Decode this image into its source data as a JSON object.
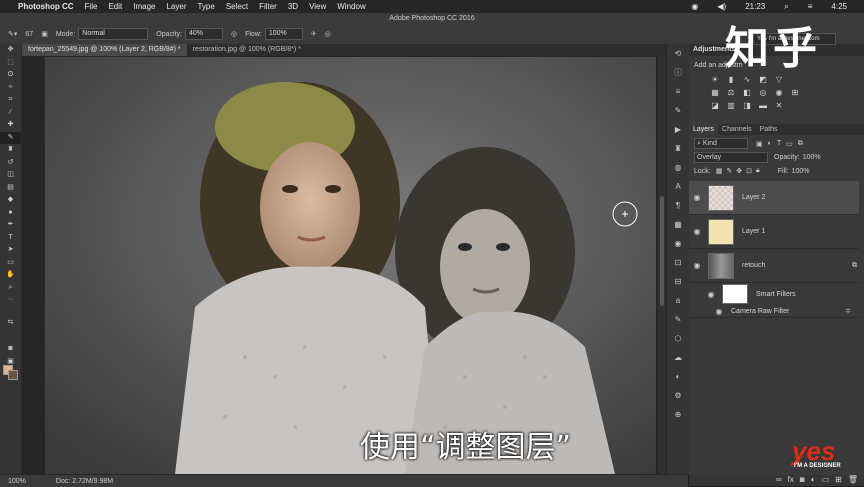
{
  "menubar": {
    "app_name": "Photoshop CC",
    "items": [
      "File",
      "Edit",
      "Image",
      "Layer",
      "Type",
      "Select",
      "Filter",
      "3D",
      "View",
      "Window"
    ],
    "clock": "21:23",
    "time": "4:25"
  },
  "window_title": "Adobe Photoshop CC 2016",
  "options_bar": {
    "brush_size": "67",
    "mode_label": "Mode:",
    "mode_value": "Normal",
    "opacity_label": "Opacity:",
    "opacity_value": "40%",
    "flow_label": "Flow:",
    "flow_value": "100%"
  },
  "doc_tabs": [
    {
      "label": "fortepan_25549.jpg @ 100% (Layer 2, RGB/8#) *"
    },
    {
      "label": "restoration.jpg @ 100% (RGB/8*) *"
    }
  ],
  "status": {
    "zoom": "100%",
    "doc": "Doc: 2.72M/9.98M"
  },
  "panel": {
    "workspace": "Yes I'm a Designer.com",
    "adjustments_title": "Adjustments",
    "adjustments_subtitle": "Add an adjustm",
    "layers_tabs": [
      "Layers",
      "Channels",
      "Paths"
    ],
    "filter_kind": "Kind",
    "blend_mode": "Overlay",
    "opacity_label": "Opacity:",
    "opacity_value": "100%",
    "lock_label": "Lock:",
    "fill_label": "Fill:",
    "fill_value": "100%"
  },
  "layers": [
    {
      "name": "Layer 2",
      "selected": true
    },
    {
      "name": "Layer 1",
      "selected": false
    },
    {
      "name": "retouch",
      "selected": false
    },
    {
      "name": "Smart Filters",
      "selected": false
    },
    {
      "name": "Camera Raw Filter",
      "selected": false
    }
  ],
  "overlay": {
    "watermark": "知乎",
    "logo": "yes",
    "logo_sub": "I'M A DESIGNER",
    "subtitle": "使用“调整图层”"
  },
  "colors": {
    "foreground": "#e2b28f",
    "background": "#6b5443",
    "accent_logo": "#e02a1a"
  }
}
